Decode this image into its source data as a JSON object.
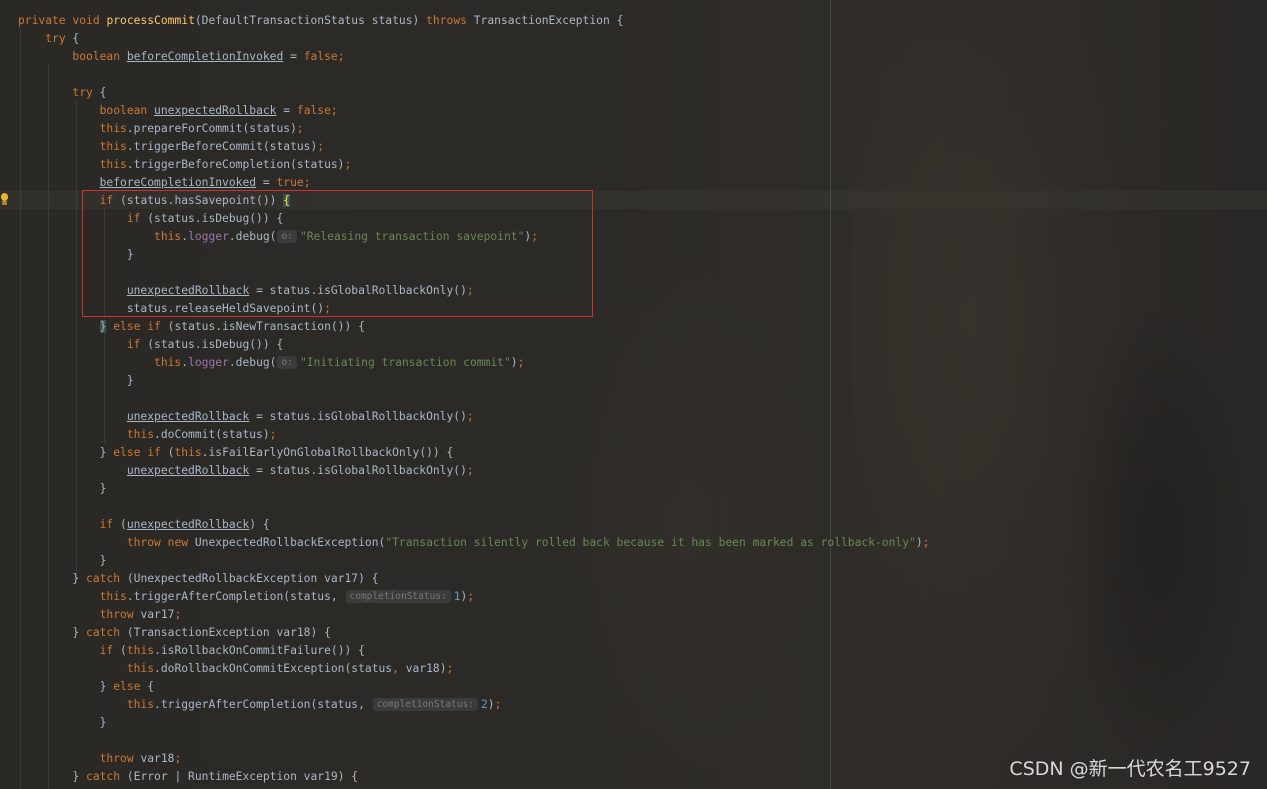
{
  "editor": {
    "hint_o": "o:",
    "hint_completion_status": "completionStatus:"
  },
  "code": {
    "l1": {
      "a": "private",
      "b": "void",
      "c": "processCommit",
      "d": "(DefaultTransactionStatus status) ",
      "e": "throws",
      "f": " TransactionException {"
    },
    "l2": {
      "a": "try",
      "b": " {"
    },
    "l3": {
      "a": "boolean",
      "b": "beforeCompletionInvoked",
      "c": " = ",
      "d": "false",
      "e": ";"
    },
    "l5": {
      "a": "try",
      "b": " {"
    },
    "l6": {
      "a": "boolean",
      "b": "unexpectedRollback",
      "c": " = ",
      "d": "false",
      "e": ";"
    },
    "l7": {
      "a": "this",
      "b": ".prepareForCommit(status)",
      "c": ";"
    },
    "l8": {
      "a": "this",
      "b": ".triggerBeforeCommit(status)",
      "c": ";"
    },
    "l9": {
      "a": "this",
      "b": ".triggerBeforeCompletion(status)",
      "c": ";"
    },
    "l10": {
      "a": "beforeCompletionInvoked",
      "b": " = ",
      "c": "true",
      "d": ";"
    },
    "l11": {
      "a": "if",
      "b": " (status.hasSavepoint()) ",
      "c": "{"
    },
    "l12": {
      "a": "if",
      "b": " (status.isDebug()) {"
    },
    "l13": {
      "a": "this",
      "b": ".",
      "c": "logger",
      "d": ".debug(",
      "e": "\"Releasing transaction savepoint\"",
      "f": ")",
      "g": ";"
    },
    "l14": {
      "a": "}"
    },
    "l16": {
      "a": "unexpectedRollback",
      "b": " = status.isGlobalRollbackOnly()",
      "c": ";"
    },
    "l17": {
      "a": "status.releaseHeldSavepoint()",
      "b": ";"
    },
    "l18": {
      "a": "}",
      "b": " else if",
      "c": " (status.isNewTransaction()) {"
    },
    "l19": {
      "a": "if",
      "b": " (status.isDebug()) {"
    },
    "l20": {
      "a": "this",
      "b": ".",
      "c": "logger",
      "d": ".debug(",
      "e": "\"Initiating transaction commit\"",
      "f": ")",
      "g": ";"
    },
    "l21": {
      "a": "}"
    },
    "l23": {
      "a": "unexpectedRollback",
      "b": " = status.isGlobalRollbackOnly()",
      "c": ";"
    },
    "l24": {
      "a": "this",
      "b": ".doCommit(status)",
      "c": ";"
    },
    "l25": {
      "a": "} ",
      "b": "else if",
      "c": " (",
      "d": "this",
      "e": ".isFailEarlyOnGlobalRollbackOnly()) {"
    },
    "l26": {
      "a": "unexpectedRollback",
      "b": " = status.isGlobalRollbackOnly()",
      "c": ";"
    },
    "l27": {
      "a": "}"
    },
    "l29": {
      "a": "if",
      "b": " (",
      "c": "unexpectedRollback",
      "d": ") {"
    },
    "l30": {
      "a": "throw",
      "b": " ",
      "c": "new",
      "d": " UnexpectedRollbackException(",
      "e": "\"Transaction silently rolled back because it has been marked as rollback-only\"",
      "f": ")",
      "g": ";"
    },
    "l31": {
      "a": "}"
    },
    "l32": {
      "a": "} ",
      "b": "catch",
      "c": " (UnexpectedRollbackException var17) {"
    },
    "l33": {
      "a": "this",
      "b": ".triggerAfterCompletion(status, ",
      "c": "1",
      "d": ")",
      "e": ";"
    },
    "l34": {
      "a": "throw",
      "b": " var17",
      "c": ";"
    },
    "l35": {
      "a": "} ",
      "b": "catch",
      "c": " (TransactionException var18) {"
    },
    "l36": {
      "a": "if",
      "b": " (",
      "c": "this",
      "d": ".isRollbackOnCommitFailure()) {"
    },
    "l37": {
      "a": "this",
      "b": ".doRollbackOnCommitException(status",
      "c": ", ",
      "d": "var18)",
      "e": ";"
    },
    "l38": {
      "a": "} ",
      "b": "else",
      "c": " {"
    },
    "l39": {
      "a": "this",
      "b": ".triggerAfterCompletion(status, ",
      "c": "2",
      "d": ")",
      "e": ";"
    },
    "l40": {
      "a": "}"
    },
    "l42": {
      "a": "throw",
      "b": " var18",
      "c": ";"
    },
    "l43": {
      "a": "} ",
      "b": "catch",
      "c": " (Error | RuntimeException var19) {"
    }
  },
  "watermark": "CSDN @新一代农名工9527",
  "colors": {
    "keyword": "#cc7832",
    "method_decl": "#ffc66d",
    "string": "#6a8759",
    "field": "#9876aa",
    "number": "#6897bb",
    "default_text": "#a9b7c6",
    "highlight_box": "#d22f2f"
  },
  "icons": {
    "intention_bulb": "lightbulb-icon"
  }
}
